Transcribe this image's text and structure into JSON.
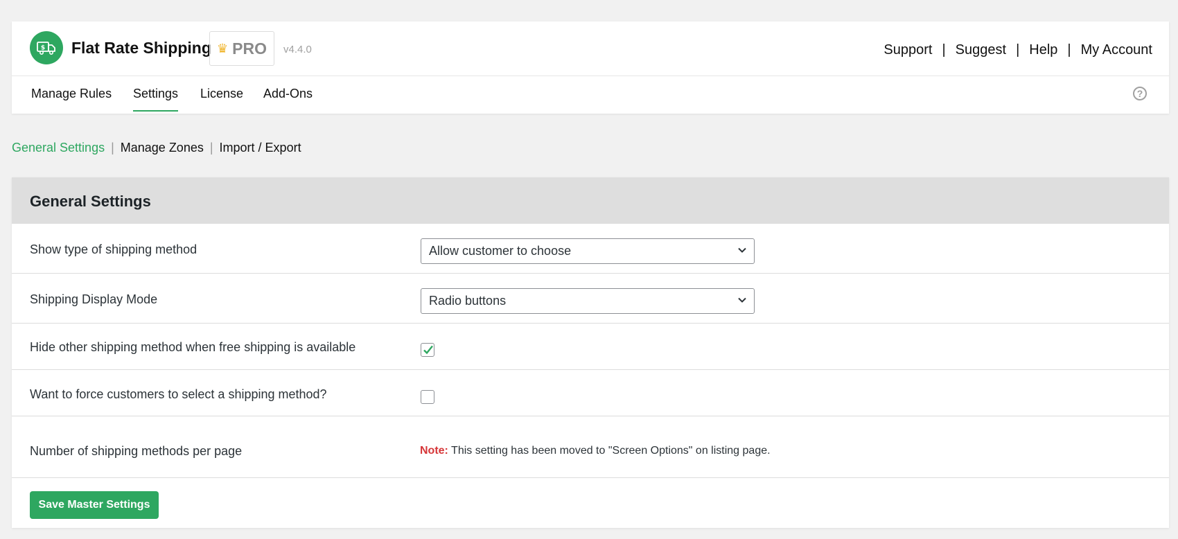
{
  "header": {
    "app_title": "Flat Rate Shipping",
    "pro_label": "PRO",
    "version": "v4.4.0",
    "links": [
      "Support",
      "Suggest",
      "Help",
      "My Account"
    ],
    "separator": "|",
    "brand_color": "#2ea760"
  },
  "main_nav": {
    "tabs": [
      {
        "label": "Manage Rules"
      },
      {
        "label": "Settings",
        "active": true
      },
      {
        "label": "License"
      },
      {
        "label": "Add-Ons"
      }
    ],
    "help_glyph": "?"
  },
  "sub_nav": {
    "items": [
      {
        "label": "General Settings",
        "active": true
      },
      {
        "label": "Manage Zones"
      },
      {
        "label": "Import / Export"
      }
    ],
    "separator": "|"
  },
  "panel": {
    "title": "General Settings",
    "rows": [
      {
        "label": "Show type of shipping method",
        "type": "select",
        "value": "Allow customer to choose"
      },
      {
        "label": "Shipping Display Mode",
        "type": "select",
        "value": "Radio buttons"
      },
      {
        "label": "Hide other shipping method when free shipping is available",
        "type": "checkbox",
        "checked": true
      },
      {
        "label": "Want to force customers to select a shipping method?",
        "type": "checkbox",
        "checked": false
      },
      {
        "label": "Number of shipping methods per page",
        "type": "note",
        "note_label": "Note:",
        "note_text": " This setting has been moved to \"Screen Options\" on listing page."
      }
    ],
    "save_label": "Save Master Settings"
  }
}
